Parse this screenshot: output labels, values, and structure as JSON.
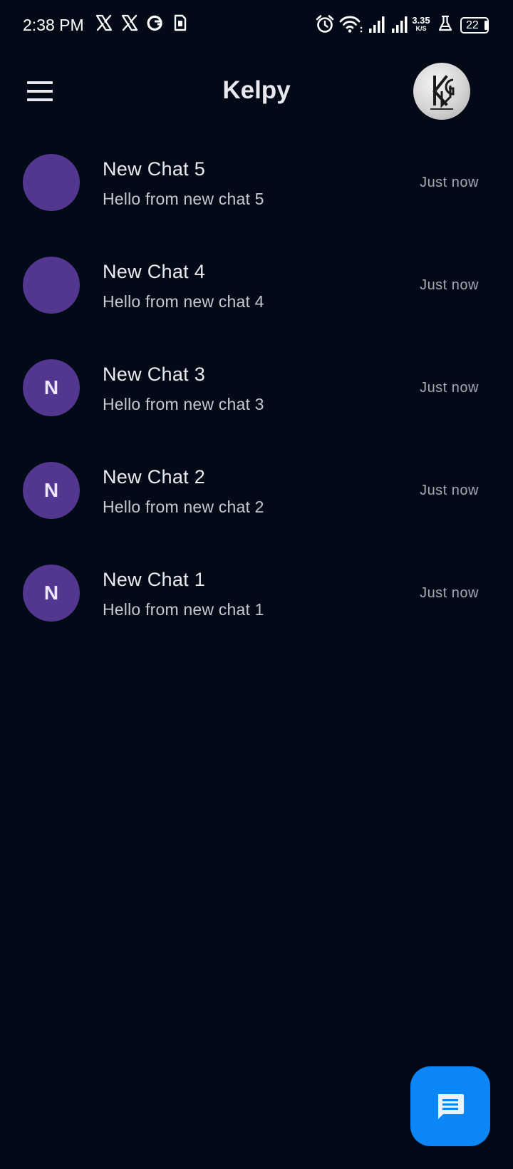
{
  "status_bar": {
    "time": "2:38 PM",
    "net_speed_value": "3.35",
    "net_speed_unit": "K/S",
    "battery": "22",
    "left_icons": [
      "x-icon",
      "x-icon",
      "vpn-icon",
      "sim-card-icon"
    ],
    "right_icons": [
      "alarm-icon",
      "wifi-icon",
      "signal-icon",
      "signal-icon",
      "lab-flask-icon",
      "battery-icon"
    ]
  },
  "app_bar": {
    "title": "Kelpy",
    "menu_icon": "hamburger-menu-icon",
    "avatar": "profile-avatar"
  },
  "chats": [
    {
      "name": "New Chat 5",
      "preview": "Hello from new chat 5",
      "time": "Just now",
      "initial": ""
    },
    {
      "name": "New Chat 4",
      "preview": "Hello from new chat 4",
      "time": "Just now",
      "initial": ""
    },
    {
      "name": "New Chat 3",
      "preview": "Hello from new chat 3",
      "time": "Just now",
      "initial": "N"
    },
    {
      "name": "New Chat 2",
      "preview": "Hello from new chat 2",
      "time": "Just now",
      "initial": "N"
    },
    {
      "name": "New Chat 1",
      "preview": "Hello from new chat 1",
      "time": "Just now",
      "initial": "N"
    }
  ],
  "fab": {
    "icon": "new-message-icon"
  },
  "colors": {
    "background": "#020a17",
    "avatar": "#53368f",
    "fab": "#0b86f6",
    "text_primary": "#ecebf2",
    "text_secondary": "#c7c7d1",
    "text_muted": "#a7a7b3"
  }
}
